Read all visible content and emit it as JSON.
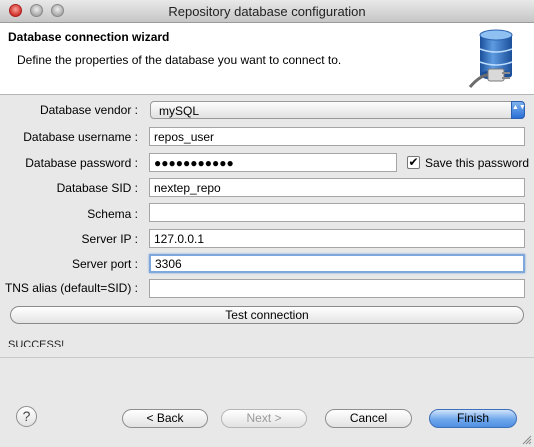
{
  "window": {
    "title": "Repository database configuration"
  },
  "header": {
    "title": "Database connection wizard",
    "description": "Define the properties of the database you want to connect to."
  },
  "form": {
    "vendor": {
      "label": "Database vendor :",
      "value": "mySQL"
    },
    "username": {
      "label": "Database username :",
      "value": "repos_user"
    },
    "password": {
      "label": "Database password :",
      "value": "●●●●●●●●●●●",
      "save_label": "Save this password",
      "save_checked": true
    },
    "sid": {
      "label": "Database SID :",
      "value": "nextep_repo"
    },
    "schema": {
      "label": "Schema :",
      "value": ""
    },
    "server_ip": {
      "label": "Server IP :",
      "value": "127.0.0.1"
    },
    "server_port": {
      "label": "Server port :",
      "value": "3306"
    },
    "tns_alias": {
      "label": "TNS alias (default=SID) :",
      "value": ""
    }
  },
  "test_button": {
    "label": "Test connection"
  },
  "status": {
    "text": "SUCCESS!"
  },
  "footer": {
    "help": "?",
    "back": "< Back",
    "next": "Next >",
    "cancel": "Cancel",
    "finish": "Finish"
  },
  "icons": {
    "checkmark": "✔",
    "select_arrows": "▲▼"
  }
}
